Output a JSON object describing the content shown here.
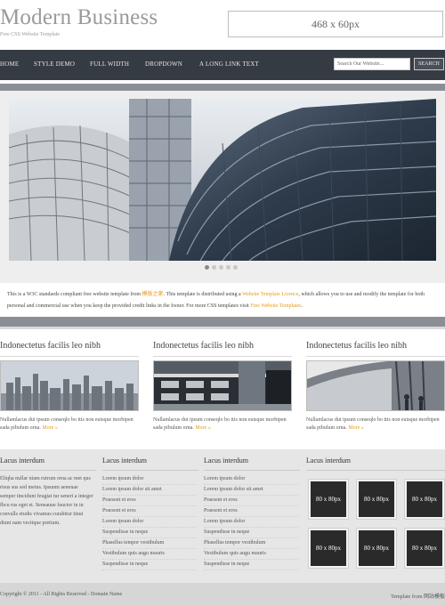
{
  "header": {
    "brand": "Modern Business",
    "subtitle": "Free CSS Website Template",
    "ad_label": "468 x 60px"
  },
  "nav": {
    "items": [
      "HOME",
      "STYLE DEMO",
      "FULL WIDTH",
      "DROPDOWN",
      "A LONG LINK TEXT"
    ],
    "search_placeholder": "Search Our Website...",
    "search_button": "SEARCH"
  },
  "slider": {
    "dots": 5,
    "active_dot": 1
  },
  "intro": {
    "part1": "This is a W3C standards compliant free website template from ",
    "link1": "模板之家",
    "part2": ". This template is distributed using a ",
    "link2": "Website Template Licence",
    "part3": ", which allows you to use and modify the template for both personal and commercial use when you keep the provided credit links in the footer. For more CSS templates visit ",
    "link3": "Free Website Templates",
    "part4": "."
  },
  "columns": [
    {
      "title": "Indonectetus facilis leo nibh",
      "text": "Nullamlacus dui ipsum conseqlo bo ttis non euisque morbipen sada pibulum orna.",
      "more": "More »"
    },
    {
      "title": "Indonectetus facilis leo nibh",
      "text": "Nullamlacus dui ipsum conseqlo bo ttis non euisque morbipen sada pibulum orna.",
      "more": "More »"
    },
    {
      "title": "Indonectetus facilis leo nibh",
      "text": "Nullamlacus dui ipsum conseqlo bo ttis non euisque morbipen sada pibulum orna.",
      "more": "More »"
    }
  ],
  "lower": {
    "col1": {
      "title": "Lacus interdum",
      "para": "Eliqha nullar niam rutrum orna ac met qus risus sus sed metus. Ipsunm aenenae semper tincidunt feugiat tur seneri a integer fhcu rus eget et. Seneauue fauctor in in convalls etudis vivamus curabitur tinui diunt nam vectique pretium."
    },
    "col2": {
      "title": "Lacus interdum",
      "items": [
        "Lorem ipsum dolor",
        "Lorem ipsum dolor sit amet",
        "Praesent et eros",
        "Praesent et eros",
        "Lorem ipsum dolor",
        "Suspendisse in neque",
        "Phasellus tempor vestibulum",
        "Vestibulum quis augu mauris",
        "Suspendisse in neque"
      ]
    },
    "col3": {
      "title": "Lacus interdum",
      "items": [
        "Lorem ipsum dolor",
        "Lorem ipsum dolor sit amet",
        "Praesent et eros",
        "Praesent et eros",
        "Lorem ipsum dolor",
        "Suspendisse in neque",
        "Phasellus tempor vestibulum",
        "Vestibulum quis augu mauris",
        "Suspendisse in neque"
      ]
    },
    "col4": {
      "title": "Lacus interdum",
      "thumbs": [
        "80 x 80px",
        "80 x 80px",
        "80 x 80px",
        "80 x 80px",
        "80 x 80px",
        "80 x 80px"
      ]
    }
  },
  "footer": {
    "left": "Copyright © 2011 - All Rights Reserved - Domain Name",
    "right": "Template from 网站模板"
  },
  "colors": {
    "nav_bg": "#353b43",
    "accent_link": "#e49a18",
    "subbar": "#8b8f95"
  }
}
